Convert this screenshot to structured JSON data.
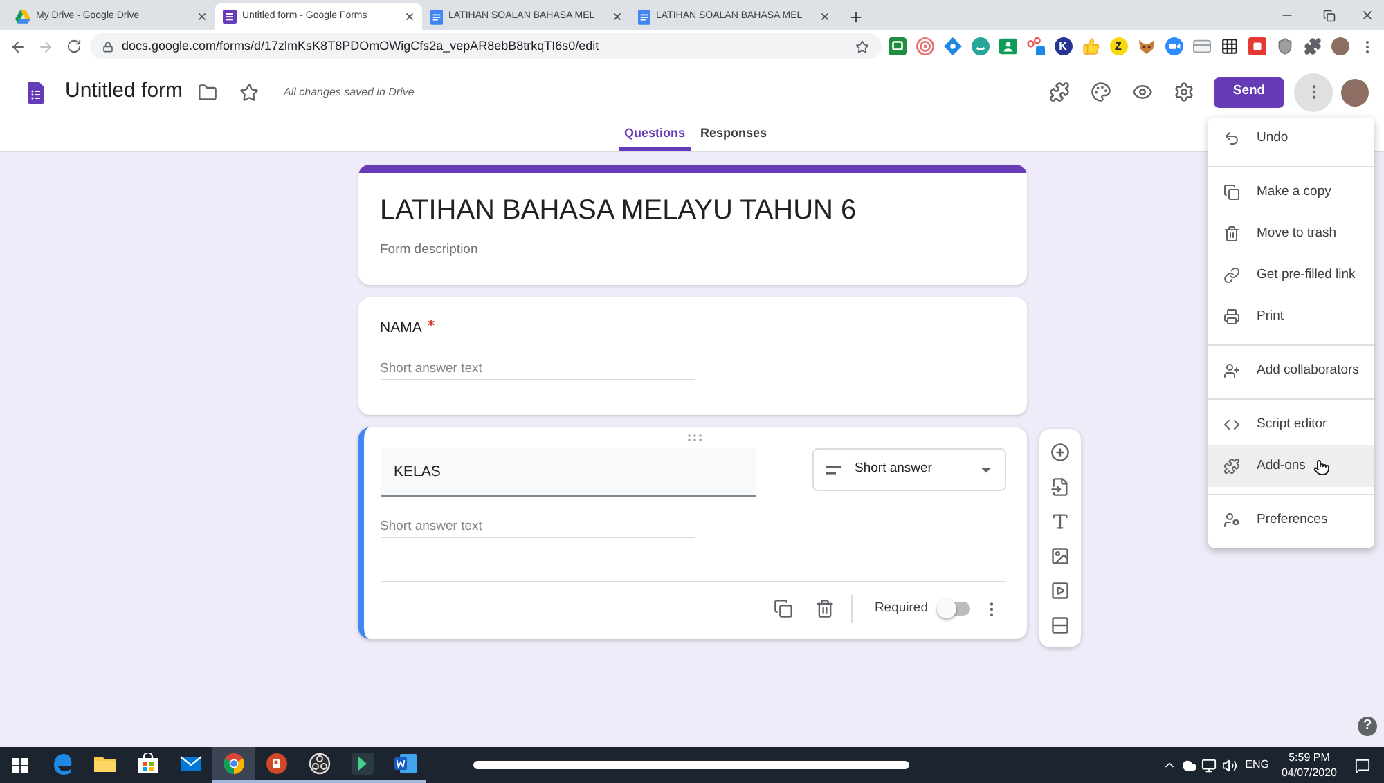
{
  "browser": {
    "tabs": [
      {
        "title": "My Drive - Google Drive",
        "kind": "drive",
        "selected": false
      },
      {
        "title": "Untitled form - Google Forms",
        "kind": "forms",
        "selected": true
      },
      {
        "title": "LATIHAN SOALAN BAHASA MEL",
        "kind": "docs",
        "selected": false
      },
      {
        "title": "LATIHAN SOALAN BAHASA MEL",
        "kind": "docs",
        "selected": false
      }
    ],
    "url": "docs.google.com/forms/d/17zlmKsK8T8PDOmOWigCfs2a_vepAR8ebB8trkqTI6s0/edit",
    "extensions": [
      {
        "kind": "screen"
      },
      {
        "kind": "target"
      },
      {
        "kind": "diamond"
      },
      {
        "kind": "bubble"
      },
      {
        "kind": "board"
      },
      {
        "kind": "share"
      },
      {
        "kind": "letter",
        "label": "K",
        "color": "#283593"
      },
      {
        "kind": "thumb"
      },
      {
        "kind": "letter",
        "label": "Z",
        "color": "#f5d90a"
      },
      {
        "kind": "fox"
      },
      {
        "kind": "camera"
      },
      {
        "kind": "card"
      },
      {
        "kind": "grid"
      },
      {
        "kind": "tile"
      },
      {
        "kind": "shield"
      },
      {
        "kind": "puzzle"
      }
    ]
  },
  "forms_header": {
    "title": "Untitled form",
    "save_status": "All changes saved in Drive",
    "send_label": "Send"
  },
  "view_tabs": [
    {
      "label": "Questions",
      "selected": true
    },
    {
      "label": "Responses",
      "selected": false
    }
  ],
  "form": {
    "title": "LATIHAN BAHASA MELAYU TAHUN 6",
    "description": {
      "placeholder": "Form description"
    },
    "questions": [
      {
        "title": "NAMA",
        "required": true,
        "active": false,
        "placeholder": "Short answer text"
      },
      {
        "title": "KELAS",
        "required": false,
        "active": true,
        "placeholder": "Short answer text",
        "type_label": "Short answer",
        "required_label": "Required"
      }
    ]
  },
  "more_menu": {
    "open": true,
    "sections": [
      {
        "items": [
          {
            "label": "Undo",
            "highlighted": false
          }
        ]
      },
      {
        "items": [
          {
            "label": "Make a copy",
            "highlighted": false
          },
          {
            "label": "Move to trash",
            "highlighted": false
          },
          {
            "label": "Get pre-filled link",
            "highlighted": false
          },
          {
            "label": "Print",
            "highlighted": false
          }
        ]
      },
      {
        "items": [
          {
            "label": "Add collaborators",
            "highlighted": false
          }
        ]
      },
      {
        "items": [
          {
            "label": "Script editor",
            "highlighted": false
          },
          {
            "label": "Add-ons",
            "highlighted": true
          }
        ]
      },
      {
        "items": [
          {
            "label": "Preferences",
            "highlighted": false
          }
        ]
      }
    ]
  },
  "help_label": "?",
  "taskbar": {
    "apps": [
      {
        "kind": "edge",
        "selected": false,
        "running": false
      },
      {
        "kind": "explorer",
        "selected": false,
        "running": false
      },
      {
        "kind": "store",
        "selected": false,
        "running": false
      },
      {
        "kind": "mail",
        "selected": false,
        "running": false
      },
      {
        "kind": "chrome",
        "selected": true,
        "running": true
      },
      {
        "kind": "powerpoint",
        "selected": false,
        "running": true
      },
      {
        "kind": "obs",
        "selected": false,
        "running": true
      },
      {
        "kind": "arrow",
        "selected": false,
        "running": true
      },
      {
        "kind": "word",
        "selected": false,
        "running": true
      }
    ],
    "language": "ENG",
    "time": "5:59 PM",
    "date": "04/07/2020"
  }
}
